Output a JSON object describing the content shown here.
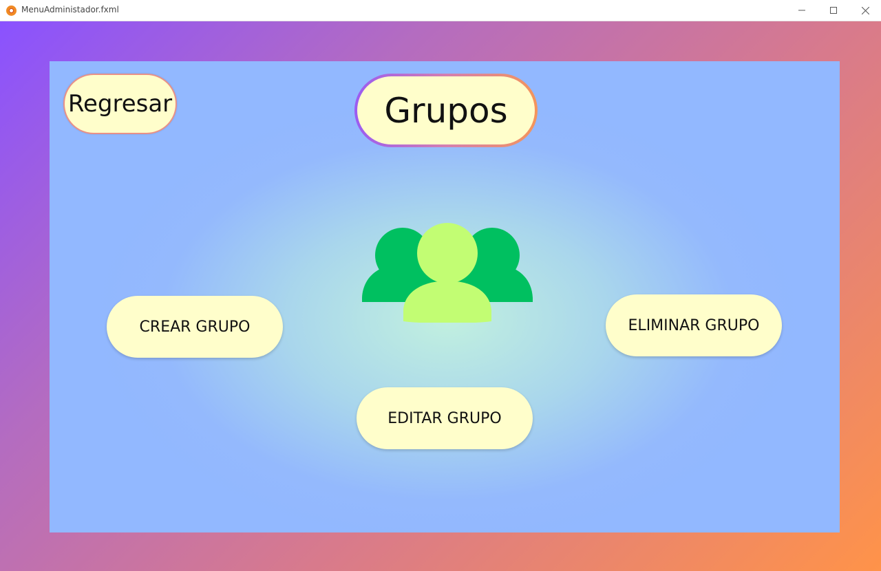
{
  "window": {
    "title": "MenuAdministador.fxml",
    "controls": [
      "minimize-icon",
      "maximize-icon",
      "close-icon"
    ]
  },
  "header": {
    "back_label": "Regresar",
    "title": "Grupos"
  },
  "actions": {
    "create_label": "CREAR GRUPO",
    "delete_label": "ELIMINAR GRUPO",
    "edit_label": "EDITAR GRUPO"
  },
  "icons": {
    "center": "group-users-icon",
    "app": "app-logo-icon"
  },
  "colors": {
    "pill_background": "#fffecb",
    "panel_center": "#c1f0df",
    "panel_edge": "#92b8ff",
    "frame_start": "#8a52ff",
    "frame_end": "#ff9349",
    "icon_dark_green": "#00c060",
    "icon_light_green": "#c2fd73"
  }
}
